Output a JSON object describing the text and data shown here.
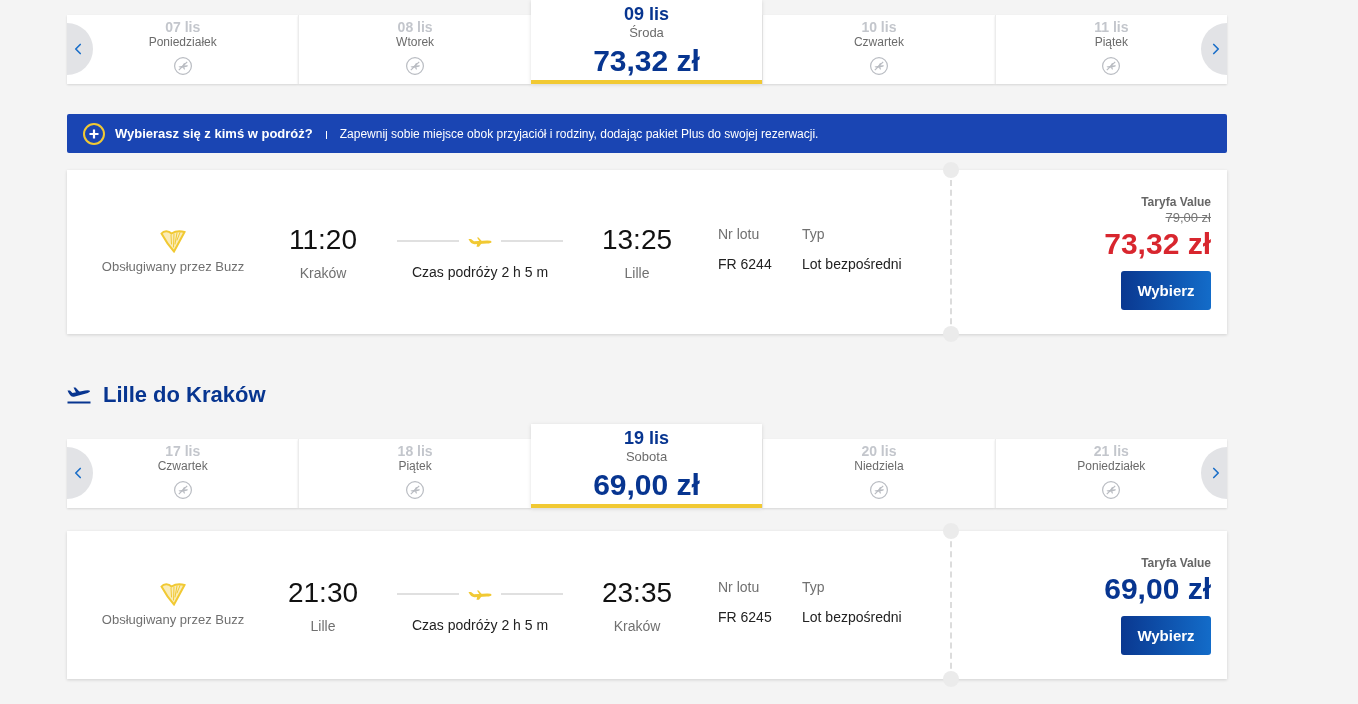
{
  "outbound_dates": [
    {
      "date": "07 lis",
      "weekday": "Poniedziałek",
      "selected": false
    },
    {
      "date": "08 lis",
      "weekday": "Wtorek",
      "selected": false
    },
    {
      "date": "09 lis",
      "weekday": "Środa",
      "price": "73,32 zł",
      "selected": true
    },
    {
      "date": "10 lis",
      "weekday": "Czwartek",
      "selected": false
    },
    {
      "date": "11 lis",
      "weekday": "Piątek",
      "selected": false
    }
  ],
  "banner": {
    "title": "Wybierasz się z kimś w podróż?",
    "text": "Zapewnij sobie miejsce obok przyjaciół i rodziny, dodając pakiet Plus do swojej rezerwacji."
  },
  "outbound_flight": {
    "operator": "Obsługiwany przez Buzz",
    "departure_time": "11:20",
    "departure_city": "Kraków",
    "duration": "Czas podróży 2 h 5 m",
    "arrival_time": "13:25",
    "arrival_city": "Lille",
    "flight_no_label": "Nr lotu",
    "flight_no": "FR 6244",
    "type_label": "Typ",
    "type": "Lot bezpośredni",
    "fare_label": "Taryfa Value",
    "old_price": "79,00 zł",
    "price": "73,32 zł",
    "promo": true,
    "button": "Wybierz"
  },
  "return_heading": "Lille do Kraków",
  "return_dates": [
    {
      "date": "17 lis",
      "weekday": "Czwartek",
      "selected": false
    },
    {
      "date": "18 lis",
      "weekday": "Piątek",
      "selected": false
    },
    {
      "date": "19 lis",
      "weekday": "Sobota",
      "price": "69,00 zł",
      "selected": true
    },
    {
      "date": "20 lis",
      "weekday": "Niedziela",
      "selected": false
    },
    {
      "date": "21 lis",
      "weekday": "Poniedziałek",
      "selected": false
    }
  ],
  "return_flight": {
    "operator": "Obsługiwany przez Buzz",
    "departure_time": "21:30",
    "departure_city": "Lille",
    "duration": "Czas podróży 2 h 5 m",
    "arrival_time": "23:35",
    "arrival_city": "Kraków",
    "flight_no_label": "Nr lotu",
    "flight_no": "FR 6245",
    "type_label": "Typ",
    "type": "Lot bezpośredni",
    "fare_label": "Taryfa Value",
    "price": "69,00 zł",
    "promo": false,
    "button": "Wybierz"
  }
}
